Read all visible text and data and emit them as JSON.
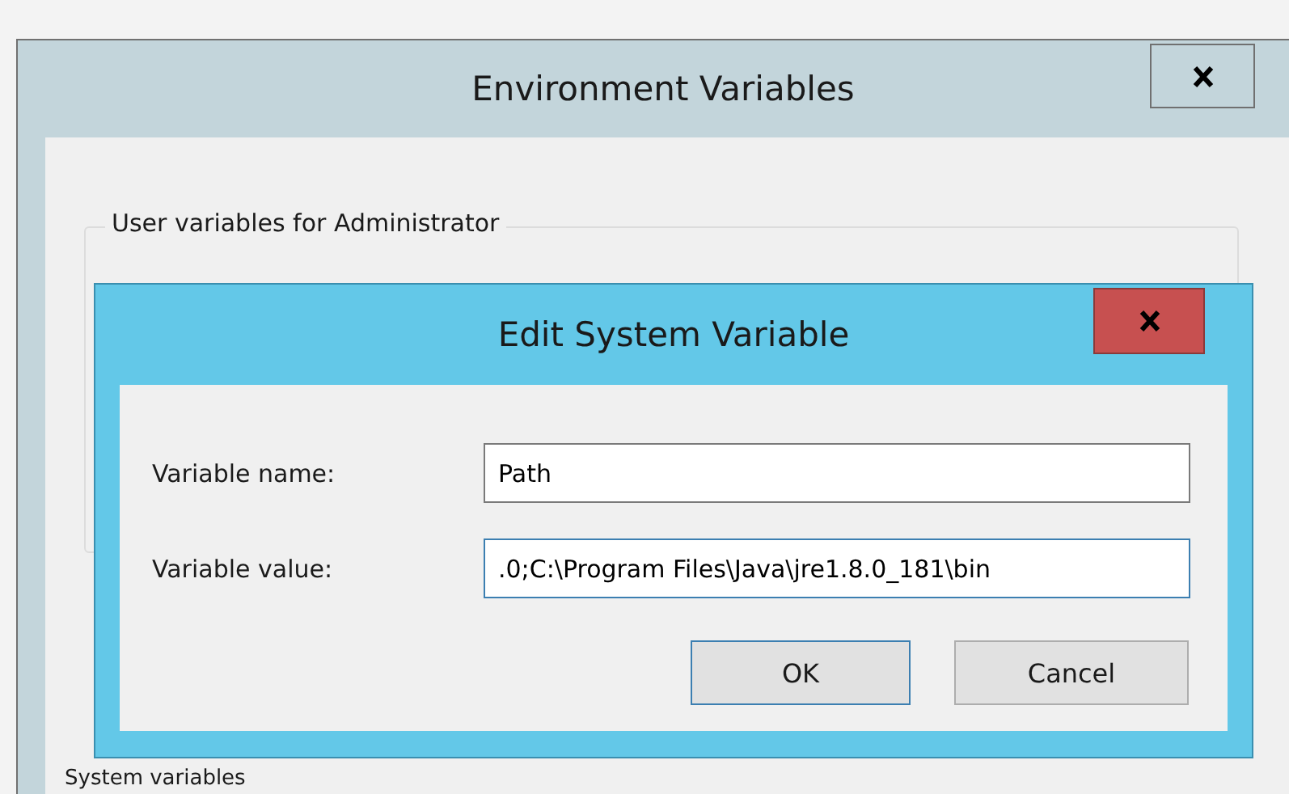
{
  "window": {
    "title": "Environment Variables",
    "group_title": "User variables for Administrator",
    "section_title": "System variables"
  },
  "dialog": {
    "title": "Edit System Variable",
    "fields": [
      {
        "label": "Variable name:",
        "value": "Path",
        "focused": false
      },
      {
        "label": "Variable value:",
        "value": ".0;C:\\Program Files\\Java\\jre1.8.0_181\\bin",
        "focused": true
      }
    ],
    "buttons": [
      {
        "label": "OK",
        "default": true
      },
      {
        "label": "Cancel",
        "default": false
      }
    ]
  }
}
